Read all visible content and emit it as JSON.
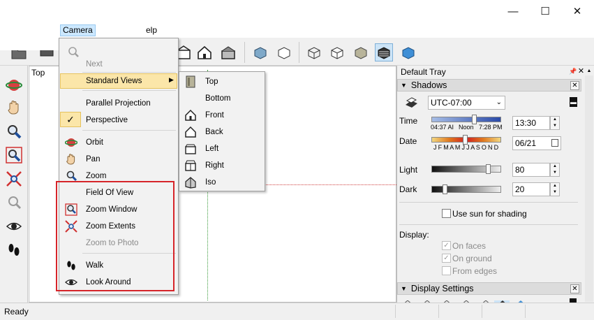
{
  "menubar": {
    "camera": "Camera",
    "help_fragment": "elp"
  },
  "window": {
    "minimize": "—",
    "maximize": "☐",
    "close": "✕"
  },
  "canvas": {
    "scene_label": "Top"
  },
  "camera_menu": {
    "next": "Next",
    "standard_views": "Standard Views",
    "parallel_projection": "Parallel Projection",
    "perspective": "Perspective",
    "perspective_check": "✓",
    "orbit": "Orbit",
    "pan": "Pan",
    "zoom": "Zoom",
    "field_of_view": "Field Of View",
    "zoom_window": "Zoom Window",
    "zoom_extents": "Zoom Extents",
    "zoom_to_photo": "Zoom to Photo",
    "walk": "Walk",
    "look_around": "Look Around"
  },
  "standard_views": [
    "Top",
    "Bottom",
    "Front",
    "Back",
    "Left",
    "Right",
    "Iso"
  ],
  "tray": {
    "title": "Default Tray",
    "pin": "📌",
    "close": "✕",
    "shadows": {
      "header": "Shadows",
      "timezone": "UTC-07:00",
      "time_label": "Time",
      "time_start": "04:37 AI",
      "time_noon": "Noon",
      "time_end": "7:28 PM",
      "time_value": "13:30",
      "date_label": "Date",
      "months": "J F M A M J J A S O N D",
      "date_value": "06/21",
      "light_label": "Light",
      "light_value": "80",
      "dark_label": "Dark",
      "dark_value": "20",
      "use_sun": "Use sun for shading",
      "display_label": "Display:",
      "on_faces": "On faces",
      "on_ground": "On ground",
      "from_edges": "From edges",
      "check_mark": "✓"
    },
    "display_settings": {
      "header": "Display Settings"
    }
  },
  "status": {
    "text": "Ready"
  },
  "colors": {
    "highlight": "#fbe6a9",
    "red_box": "#d6252a",
    "menu_bg": "#f2f2f2"
  }
}
